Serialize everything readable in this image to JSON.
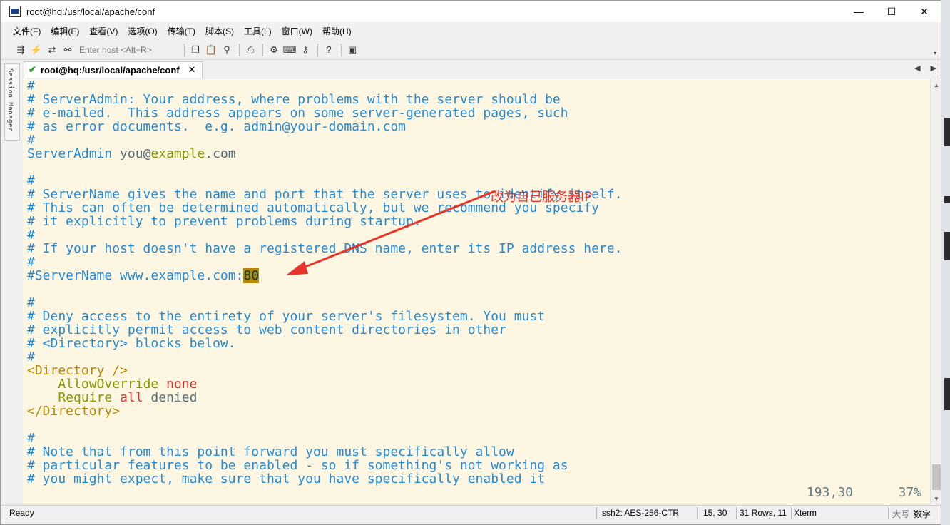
{
  "window": {
    "title": "root@hq:/usr/local/apache/conf",
    "controls": {
      "minimize": "—",
      "maximize": "☐",
      "close": "✕"
    }
  },
  "menu": [
    "文件(F)",
    "编辑(E)",
    "查看(V)",
    "选项(O)",
    "传输(T)",
    "脚本(S)",
    "工具(L)",
    "窗口(W)",
    "帮助(H)"
  ],
  "toolbar": {
    "host_placeholder": "Enter host <Alt+R>",
    "icons": [
      "connect-bar-icon",
      "quick-connect-icon",
      "reconnect-icon",
      "disconnect-icon",
      "copy-icon",
      "paste-icon",
      "find-icon",
      "print-icon",
      "settings-icon",
      "keymap-icon",
      "keygen-icon",
      "help-icon",
      "sftp-icon"
    ]
  },
  "side_panel": {
    "label": "Session Manager"
  },
  "tab": {
    "label": "root@hq:/usr/local/apache/conf",
    "check": "✔",
    "close": "✕",
    "nav_prev": "◀",
    "nav_next": "▶"
  },
  "terminal": {
    "lines": [
      "#",
      "# ServerAdmin: Your address, where problems with the server should be",
      "# e-mailed.  This address appears on some server-generated pages, such",
      "# as error documents.  e.g. admin@your-domain.com",
      "#",
      {
        "a": "ServerAdmin",
        "b": " you@",
        "c": "example",
        "d": ".com"
      },
      "",
      "#",
      "# ServerName gives the name and port that the server uses to identify itself.",
      "# This can often be determined automatically, but we recommend you specify",
      "# it explicitly to prevent problems during startup.",
      "#",
      "# If your host doesn't have a registered DNS name, enter its IP address here.",
      "#",
      {
        "pre": "#ServerName www.example.com:",
        "hl": "80"
      },
      "",
      "#",
      "# Deny access to the entirety of your server's filesystem. You must",
      "# explicitly permit access to web content directories in other",
      "# <Directory> blocks below.",
      "#",
      {
        "tag": "<Directory />"
      },
      {
        "indent": "    ",
        "key": "AllowOverride",
        "val": " none"
      },
      {
        "indent": "    ",
        "key": "Require",
        "sp": " ",
        "val": "all",
        "rest": " denied"
      },
      {
        "tag": "</Directory>"
      },
      "",
      "#",
      "# Note that from this point forward you must specifically allow",
      "# particular features to be enabled - so if something's not working as",
      "# you might expect, make sure that you have specifically enabled it"
    ],
    "cursor_position": "193,30",
    "scroll_percent": "37%"
  },
  "annotation": {
    "text": "改为自己服务器IP",
    "color": "#e8352b"
  },
  "statusbar": {
    "ready": "Ready",
    "cipher": "ssh2: AES-256-CTR",
    "position": "15,  30",
    "rows": "31 Rows, 11",
    "term": "Xterm",
    "caps": "大写",
    "num": "数字"
  },
  "colors": {
    "terminal_bg": "#fdf6e3",
    "comment": "#268bd2",
    "directive": "#859900",
    "tag": "#b58900",
    "value": "#dc322f"
  }
}
